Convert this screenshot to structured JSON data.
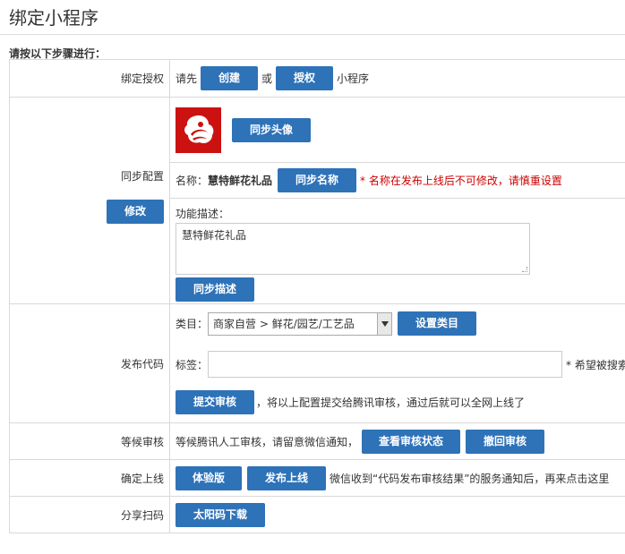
{
  "header": {
    "title": "绑定小程序",
    "subtitle": "请按以下步骤进行："
  },
  "auth": {
    "label": "绑定授权",
    "prefix": "请先",
    "create_button": "创建",
    "or": "或",
    "authorize_button": "授权",
    "suffix": "小程序"
  },
  "config": {
    "label": "同步配置",
    "edit_button": "修改",
    "sync_avatar_button": "同步头像",
    "name_label": "名称：",
    "name_value": "慧特鲜花礼品",
    "sync_name_button": "同步名称",
    "name_warning": "* 名称在发布上线后不可修改，请慎重设置",
    "desc_label": "功能描述：",
    "desc_value": "慧特鲜花礼品",
    "sync_desc_button": "同步描述"
  },
  "publish": {
    "label": "发布代码",
    "category_label": "类目：",
    "category_value": "商家自营 > 鲜花/园艺/工艺品",
    "set_category_button": "设置类目",
    "tag_label": "标签：",
    "tag_value": "",
    "tag_hint": "* 希望被搜索",
    "submit_button": "提交审核",
    "submit_hint": "，将以上配置提交给腾讯审核，通过后就可以全网上线了"
  },
  "review": {
    "label": "等候审核",
    "text": "等候腾讯人工审核，请留意微信通知，",
    "check_button": "查看审核状态",
    "withdraw_button": "撤回审核"
  },
  "release": {
    "label": "确定上线",
    "trial_button": "体验版",
    "publish_button": "发布上线",
    "hint": "微信收到“代码发布审核结果”的服务通知后，再来点击这里"
  },
  "share": {
    "label": "分享扫码",
    "download_button": "太阳码下载"
  },
  "colors": {
    "button": "#2e72b8",
    "warning": "#cc0000",
    "logo_bg": "#cc1111"
  }
}
